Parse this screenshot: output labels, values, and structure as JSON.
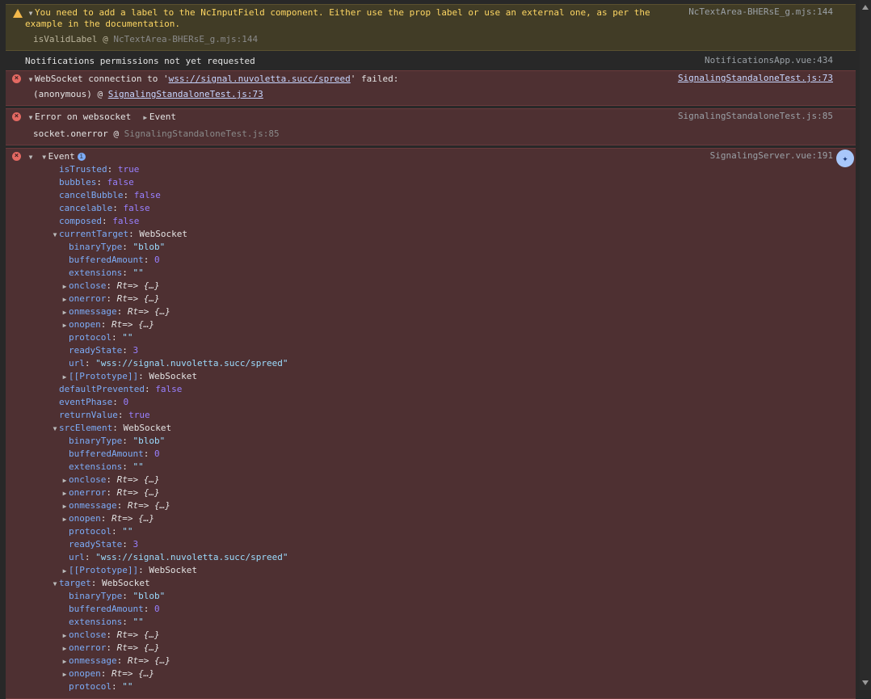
{
  "warning": {
    "arrow": "▼",
    "message_line1": "You need to add a label to the NcInputField component. Either use the prop label or use an external one, as per the",
    "message_line2": "example in the documentation.",
    "source": "NcTextArea-BHERsE_g.mjs:144",
    "trace_fn": "isValidLabel",
    "trace_at": "@",
    "trace_src": "NcTextArea-BHERsE_g.mjs:144"
  },
  "info": {
    "message": "Notifications permissions not yet requested",
    "source": "NotificationsApp.vue:434"
  },
  "ws_error": {
    "prefix": "WebSocket connection to '",
    "url": "wss://signal.nuvoletta.succ/spreed",
    "suffix": "' failed:",
    "source": "SignalingStandaloneTest.js:73",
    "trace_fn": "(anonymous)",
    "trace_at": "@",
    "trace_src": "SignalingStandaloneTest.js:73"
  },
  "socket_error": {
    "message": "Error on websocket",
    "event_label": "Event",
    "source": "SignalingStandaloneTest.js:85",
    "trace_fn": "socket.onerror",
    "trace_at": "@",
    "trace_src": "SignalingStandaloneTest.js:85"
  },
  "event_error": {
    "label": "Event",
    "info_badge": "i",
    "source": "SignalingServer.vue:191"
  },
  "tree": [
    {
      "indent": 0,
      "toggle": "",
      "key": "isTrusted",
      "sep": ": ",
      "value": "true",
      "type": "kw"
    },
    {
      "indent": 0,
      "toggle": "",
      "key": "bubbles",
      "sep": ": ",
      "value": "false",
      "type": "kw"
    },
    {
      "indent": 0,
      "toggle": "",
      "key": "cancelBubble",
      "sep": ": ",
      "value": "false",
      "type": "kw"
    },
    {
      "indent": 0,
      "toggle": "",
      "key": "cancelable",
      "sep": ": ",
      "value": "false",
      "type": "kw"
    },
    {
      "indent": 0,
      "toggle": "",
      "key": "composed",
      "sep": ": ",
      "value": "false",
      "type": "kw"
    },
    {
      "indent": 0,
      "toggle": "▼",
      "key": "currentTarget",
      "sep": ": ",
      "value": "WebSocket",
      "type": "obj"
    },
    {
      "indent": 1,
      "toggle": "",
      "key": "binaryType",
      "sep": ": ",
      "value": "\"blob\"",
      "type": "str"
    },
    {
      "indent": 1,
      "toggle": "",
      "key": "bufferedAmount",
      "sep": ": ",
      "value": "0",
      "type": "num"
    },
    {
      "indent": 1,
      "toggle": "",
      "key": "extensions",
      "sep": ": ",
      "value": "\"\"",
      "type": "str"
    },
    {
      "indent": 1,
      "toggle": "▶",
      "key": "onclose",
      "sep": ": ",
      "value": "Rt=> {…}",
      "type": "fn"
    },
    {
      "indent": 1,
      "toggle": "▶",
      "key": "onerror",
      "sep": ": ",
      "value": "Rt=> {…}",
      "type": "fn"
    },
    {
      "indent": 1,
      "toggle": "▶",
      "key": "onmessage",
      "sep": ": ",
      "value": "Rt=> {…}",
      "type": "fn"
    },
    {
      "indent": 1,
      "toggle": "▶",
      "key": "onopen",
      "sep": ": ",
      "value": "Rt=> {…}",
      "type": "fn"
    },
    {
      "indent": 1,
      "toggle": "",
      "key": "protocol",
      "sep": ": ",
      "value": "\"\"",
      "type": "str"
    },
    {
      "indent": 1,
      "toggle": "",
      "key": "readyState",
      "sep": ": ",
      "value": "3",
      "type": "num"
    },
    {
      "indent": 1,
      "toggle": "",
      "key": "url",
      "sep": ": ",
      "value": "\"wss://signal.nuvoletta.succ/spreed\"",
      "type": "str"
    },
    {
      "indent": 1,
      "toggle": "▶",
      "key": "[[Prototype]]",
      "sep": ": ",
      "value": "WebSocket",
      "type": "obj"
    },
    {
      "indent": 0,
      "toggle": "",
      "key": "defaultPrevented",
      "sep": ": ",
      "value": "false",
      "type": "kw"
    },
    {
      "indent": 0,
      "toggle": "",
      "key": "eventPhase",
      "sep": ": ",
      "value": "0",
      "type": "num"
    },
    {
      "indent": 0,
      "toggle": "",
      "key": "returnValue",
      "sep": ": ",
      "value": "true",
      "type": "kw"
    },
    {
      "indent": 0,
      "toggle": "▼",
      "key": "srcElement",
      "sep": ": ",
      "value": "WebSocket",
      "type": "obj"
    },
    {
      "indent": 1,
      "toggle": "",
      "key": "binaryType",
      "sep": ": ",
      "value": "\"blob\"",
      "type": "str"
    },
    {
      "indent": 1,
      "toggle": "",
      "key": "bufferedAmount",
      "sep": ": ",
      "value": "0",
      "type": "num"
    },
    {
      "indent": 1,
      "toggle": "",
      "key": "extensions",
      "sep": ": ",
      "value": "\"\"",
      "type": "str"
    },
    {
      "indent": 1,
      "toggle": "▶",
      "key": "onclose",
      "sep": ": ",
      "value": "Rt=> {…}",
      "type": "fn"
    },
    {
      "indent": 1,
      "toggle": "▶",
      "key": "onerror",
      "sep": ": ",
      "value": "Rt=> {…}",
      "type": "fn"
    },
    {
      "indent": 1,
      "toggle": "▶",
      "key": "onmessage",
      "sep": ": ",
      "value": "Rt=> {…}",
      "type": "fn"
    },
    {
      "indent": 1,
      "toggle": "▶",
      "key": "onopen",
      "sep": ": ",
      "value": "Rt=> {…}",
      "type": "fn"
    },
    {
      "indent": 1,
      "toggle": "",
      "key": "protocol",
      "sep": ": ",
      "value": "\"\"",
      "type": "str"
    },
    {
      "indent": 1,
      "toggle": "",
      "key": "readyState",
      "sep": ": ",
      "value": "3",
      "type": "num"
    },
    {
      "indent": 1,
      "toggle": "",
      "key": "url",
      "sep": ": ",
      "value": "\"wss://signal.nuvoletta.succ/spreed\"",
      "type": "str"
    },
    {
      "indent": 1,
      "toggle": "▶",
      "key": "[[Prototype]]",
      "sep": ": ",
      "value": "WebSocket",
      "type": "obj"
    },
    {
      "indent": 0,
      "toggle": "▼",
      "key": "target",
      "sep": ": ",
      "value": "WebSocket",
      "type": "obj"
    },
    {
      "indent": 1,
      "toggle": "",
      "key": "binaryType",
      "sep": ": ",
      "value": "\"blob\"",
      "type": "str"
    },
    {
      "indent": 1,
      "toggle": "",
      "key": "bufferedAmount",
      "sep": ": ",
      "value": "0",
      "type": "num"
    },
    {
      "indent": 1,
      "toggle": "",
      "key": "extensions",
      "sep": ": ",
      "value": "\"\"",
      "type": "str"
    },
    {
      "indent": 1,
      "toggle": "▶",
      "key": "onclose",
      "sep": ": ",
      "value": "Rt=> {…}",
      "type": "fn"
    },
    {
      "indent": 1,
      "toggle": "▶",
      "key": "onerror",
      "sep": ": ",
      "value": "Rt=> {…}",
      "type": "fn"
    },
    {
      "indent": 1,
      "toggle": "▶",
      "key": "onmessage",
      "sep": ": ",
      "value": "Rt=> {…}",
      "type": "fn"
    },
    {
      "indent": 1,
      "toggle": "▶",
      "key": "onopen",
      "sep": ": ",
      "value": "Rt=> {…}",
      "type": "fn"
    },
    {
      "indent": 1,
      "toggle": "",
      "key": "protocol",
      "sep": ": ",
      "value": "\"\"",
      "type": "str"
    }
  ],
  "icons": {
    "warning": "warning-icon",
    "error": "error-icon",
    "ai_assist": "ai-assistance-icon"
  }
}
